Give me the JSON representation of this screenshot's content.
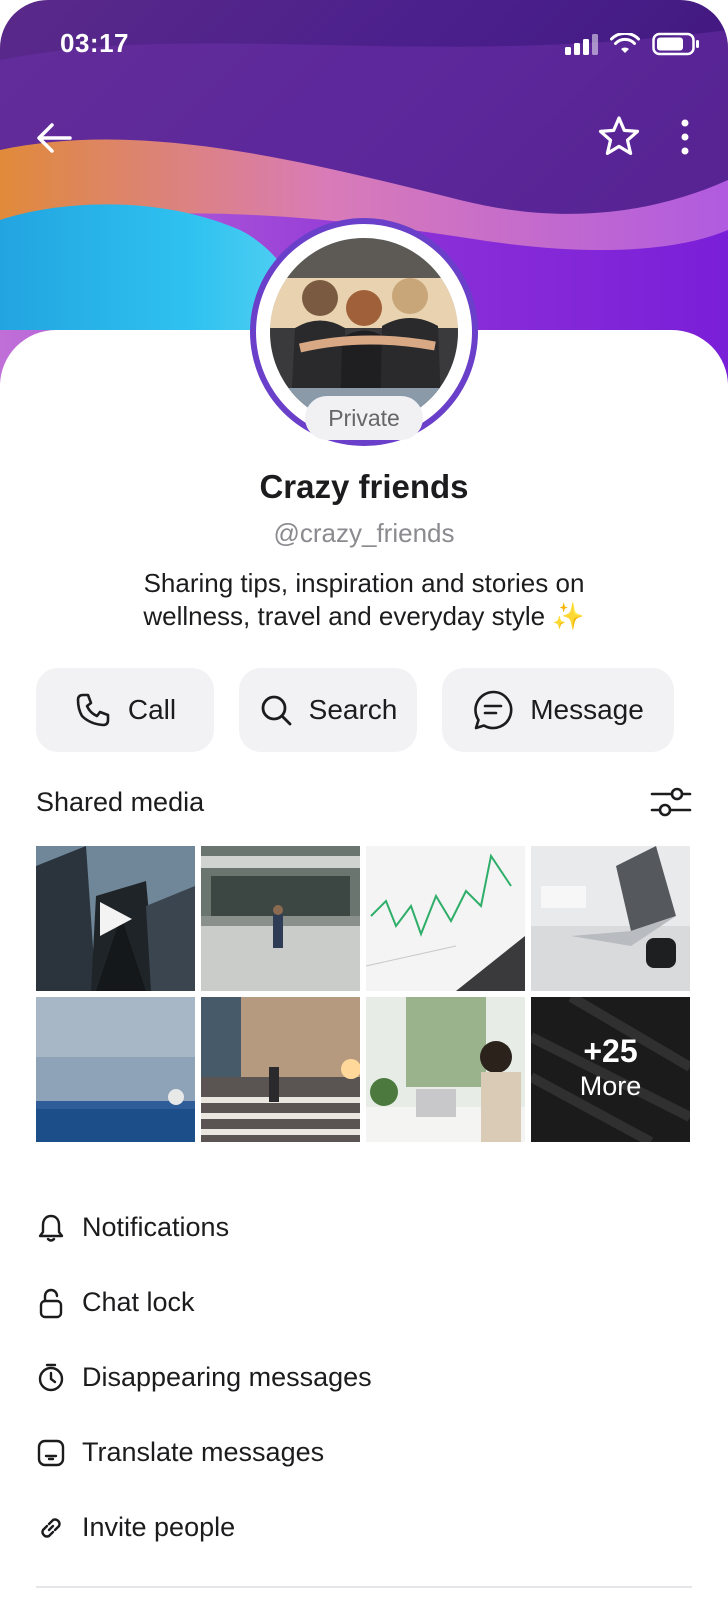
{
  "status": {
    "time": "03:17"
  },
  "header": {
    "back_icon": "back-arrow-icon",
    "favorite_icon": "star-icon",
    "more_icon": "more-vertical-icon"
  },
  "profile": {
    "badge": "Private",
    "name": "Crazy friends",
    "handle": "@crazy_friends",
    "bio_line1": "Sharing tips, inspiration and stories on",
    "bio_line2": "wellness, travel and everyday style ✨"
  },
  "actions": [
    {
      "label": "Call",
      "icon": "phone-icon"
    },
    {
      "label": "Search",
      "icon": "search-icon"
    },
    {
      "label": "Message",
      "icon": "message-icon"
    }
  ],
  "shared_media": {
    "title": "Shared media",
    "more_count": "+25",
    "more_label": "More"
  },
  "menu": [
    {
      "label": "Notifications",
      "icon": "bell-icon"
    },
    {
      "label": "Chat lock",
      "icon": "lock-icon"
    },
    {
      "label": "Disappearing messages",
      "icon": "timer-icon"
    },
    {
      "label": "Translate messages",
      "icon": "translate-icon"
    },
    {
      "label": "Invite people",
      "icon": "link-icon"
    }
  ],
  "colors": {
    "accent": "#6a3fc9",
    "button_bg": "#f2f2f4"
  }
}
